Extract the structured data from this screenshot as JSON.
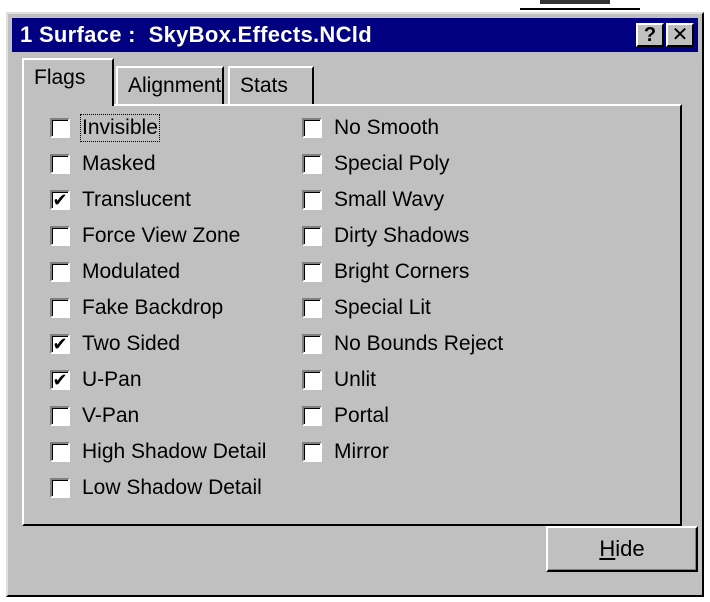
{
  "window": {
    "title": "1 Surface :  SkyBox.Effects.NCld",
    "help_glyph": "?",
    "close_glyph": "✕"
  },
  "tabs": [
    {
      "label": "Flags",
      "active": true
    },
    {
      "label": "Alignment",
      "active": false
    },
    {
      "label": "Stats",
      "active": false
    }
  ],
  "flags_left": [
    {
      "label": "Invisible",
      "checked": false,
      "focused": true
    },
    {
      "label": "Masked",
      "checked": false
    },
    {
      "label": "Translucent",
      "checked": true
    },
    {
      "label": "Force View Zone",
      "checked": false
    },
    {
      "label": "Modulated",
      "checked": false
    },
    {
      "label": "Fake Backdrop",
      "checked": false
    },
    {
      "label": "Two Sided",
      "checked": true
    },
    {
      "label": "U-Pan",
      "checked": true
    },
    {
      "label": "V-Pan",
      "checked": false
    },
    {
      "label": "High Shadow Detail",
      "checked": false
    },
    {
      "label": "Low Shadow Detail",
      "checked": false
    }
  ],
  "flags_right": [
    {
      "label": "No Smooth",
      "checked": false
    },
    {
      "label": "Special Poly",
      "checked": false
    },
    {
      "label": "Small Wavy",
      "checked": false
    },
    {
      "label": "Dirty Shadows",
      "checked": false
    },
    {
      "label": "Bright Corners",
      "checked": false
    },
    {
      "label": "Special Lit",
      "checked": false
    },
    {
      "label": "No Bounds Reject",
      "checked": false
    },
    {
      "label": "Unlit",
      "checked": false
    },
    {
      "label": "Portal",
      "checked": false
    },
    {
      "label": "Mirror",
      "checked": false
    }
  ],
  "buttons": {
    "hide_mnemonic": "H",
    "hide_rest": "ide"
  },
  "checkmark": "✔",
  "colors": {
    "titlebar": "#000080",
    "face": "#c0c0c0"
  }
}
